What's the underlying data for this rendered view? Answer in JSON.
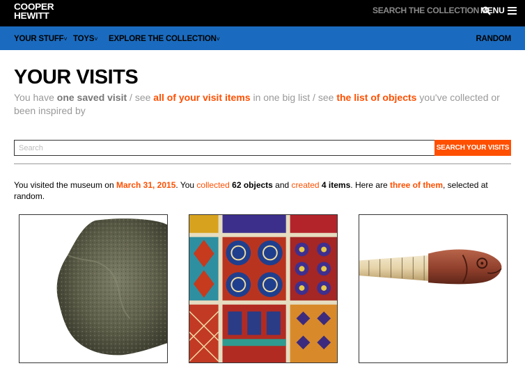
{
  "header": {
    "logo_line1": "COOPER",
    "logo_line2": "HEWITT",
    "search_label": "SEARCH THE COLLECTION",
    "search_icon": "search-icon",
    "menu_label": "MENU",
    "menu_icon": "hamburger-icon"
  },
  "nav": {
    "items": [
      {
        "label": "YOUR STUFF",
        "caret": "˅"
      },
      {
        "label": "TOYS",
        "caret": "˅"
      },
      {
        "label": "EXPLORE THE COLLECTION",
        "caret": "˅"
      }
    ],
    "random_label": "RANDOM"
  },
  "main": {
    "title": "YOUR VISITS",
    "intro": {
      "p1": "You have ",
      "saved": "one saved visit",
      "p2": " / see ",
      "link1": "all of your visit items",
      "p3": " in one big list / see ",
      "link2": "the list of objects",
      "p4": " you've collected or been inspired by"
    },
    "search": {
      "placeholder": "Search",
      "button_label": "SEARCH YOUR VISITS"
    },
    "visit": {
      "t1": "You visited the museum on ",
      "date": "March 31, 2015",
      "t2": ". You ",
      "collected_link": "collected",
      "t3": " ",
      "objects_count": "62 objects",
      "t4": " and ",
      "created_link": "created",
      "t5": " ",
      "items_count": "4 items",
      "t6": ". Here are ",
      "three_link": "three of them",
      "t7": ", selected at random."
    },
    "objects": [
      {
        "name": "rock-specimen-image"
      },
      {
        "name": "patterned-textile-image"
      },
      {
        "name": "carved-fish-handle-image"
      }
    ]
  },
  "colors": {
    "accent": "#ff4f00",
    "nav_blue": "#1a6bbf",
    "header_black": "#000000"
  }
}
